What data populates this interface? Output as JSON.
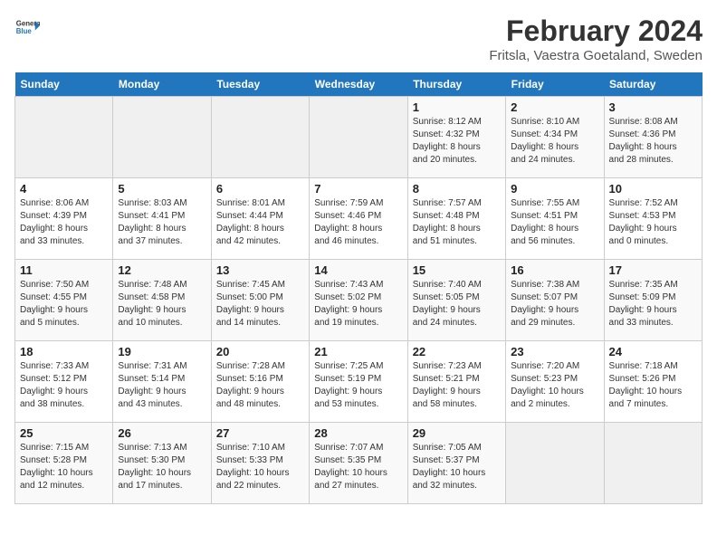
{
  "header": {
    "logo_line1": "General",
    "logo_line2": "Blue",
    "month": "February 2024",
    "location": "Fritsla, Vaestra Goetaland, Sweden"
  },
  "days_of_week": [
    "Sunday",
    "Monday",
    "Tuesday",
    "Wednesday",
    "Thursday",
    "Friday",
    "Saturday"
  ],
  "weeks": [
    [
      {
        "num": "",
        "info": ""
      },
      {
        "num": "",
        "info": ""
      },
      {
        "num": "",
        "info": ""
      },
      {
        "num": "",
        "info": ""
      },
      {
        "num": "1",
        "info": "Sunrise: 8:12 AM\nSunset: 4:32 PM\nDaylight: 8 hours\nand 20 minutes."
      },
      {
        "num": "2",
        "info": "Sunrise: 8:10 AM\nSunset: 4:34 PM\nDaylight: 8 hours\nand 24 minutes."
      },
      {
        "num": "3",
        "info": "Sunrise: 8:08 AM\nSunset: 4:36 PM\nDaylight: 8 hours\nand 28 minutes."
      }
    ],
    [
      {
        "num": "4",
        "info": "Sunrise: 8:06 AM\nSunset: 4:39 PM\nDaylight: 8 hours\nand 33 minutes."
      },
      {
        "num": "5",
        "info": "Sunrise: 8:03 AM\nSunset: 4:41 PM\nDaylight: 8 hours\nand 37 minutes."
      },
      {
        "num": "6",
        "info": "Sunrise: 8:01 AM\nSunset: 4:44 PM\nDaylight: 8 hours\nand 42 minutes."
      },
      {
        "num": "7",
        "info": "Sunrise: 7:59 AM\nSunset: 4:46 PM\nDaylight: 8 hours\nand 46 minutes."
      },
      {
        "num": "8",
        "info": "Sunrise: 7:57 AM\nSunset: 4:48 PM\nDaylight: 8 hours\nand 51 minutes."
      },
      {
        "num": "9",
        "info": "Sunrise: 7:55 AM\nSunset: 4:51 PM\nDaylight: 8 hours\nand 56 minutes."
      },
      {
        "num": "10",
        "info": "Sunrise: 7:52 AM\nSunset: 4:53 PM\nDaylight: 9 hours\nand 0 minutes."
      }
    ],
    [
      {
        "num": "11",
        "info": "Sunrise: 7:50 AM\nSunset: 4:55 PM\nDaylight: 9 hours\nand 5 minutes."
      },
      {
        "num": "12",
        "info": "Sunrise: 7:48 AM\nSunset: 4:58 PM\nDaylight: 9 hours\nand 10 minutes."
      },
      {
        "num": "13",
        "info": "Sunrise: 7:45 AM\nSunset: 5:00 PM\nDaylight: 9 hours\nand 14 minutes."
      },
      {
        "num": "14",
        "info": "Sunrise: 7:43 AM\nSunset: 5:02 PM\nDaylight: 9 hours\nand 19 minutes."
      },
      {
        "num": "15",
        "info": "Sunrise: 7:40 AM\nSunset: 5:05 PM\nDaylight: 9 hours\nand 24 minutes."
      },
      {
        "num": "16",
        "info": "Sunrise: 7:38 AM\nSunset: 5:07 PM\nDaylight: 9 hours\nand 29 minutes."
      },
      {
        "num": "17",
        "info": "Sunrise: 7:35 AM\nSunset: 5:09 PM\nDaylight: 9 hours\nand 33 minutes."
      }
    ],
    [
      {
        "num": "18",
        "info": "Sunrise: 7:33 AM\nSunset: 5:12 PM\nDaylight: 9 hours\nand 38 minutes."
      },
      {
        "num": "19",
        "info": "Sunrise: 7:31 AM\nSunset: 5:14 PM\nDaylight: 9 hours\nand 43 minutes."
      },
      {
        "num": "20",
        "info": "Sunrise: 7:28 AM\nSunset: 5:16 PM\nDaylight: 9 hours\nand 48 minutes."
      },
      {
        "num": "21",
        "info": "Sunrise: 7:25 AM\nSunset: 5:19 PM\nDaylight: 9 hours\nand 53 minutes."
      },
      {
        "num": "22",
        "info": "Sunrise: 7:23 AM\nSunset: 5:21 PM\nDaylight: 9 hours\nand 58 minutes."
      },
      {
        "num": "23",
        "info": "Sunrise: 7:20 AM\nSunset: 5:23 PM\nDaylight: 10 hours\nand 2 minutes."
      },
      {
        "num": "24",
        "info": "Sunrise: 7:18 AM\nSunset: 5:26 PM\nDaylight: 10 hours\nand 7 minutes."
      }
    ],
    [
      {
        "num": "25",
        "info": "Sunrise: 7:15 AM\nSunset: 5:28 PM\nDaylight: 10 hours\nand 12 minutes."
      },
      {
        "num": "26",
        "info": "Sunrise: 7:13 AM\nSunset: 5:30 PM\nDaylight: 10 hours\nand 17 minutes."
      },
      {
        "num": "27",
        "info": "Sunrise: 7:10 AM\nSunset: 5:33 PM\nDaylight: 10 hours\nand 22 minutes."
      },
      {
        "num": "28",
        "info": "Sunrise: 7:07 AM\nSunset: 5:35 PM\nDaylight: 10 hours\nand 27 minutes."
      },
      {
        "num": "29",
        "info": "Sunrise: 7:05 AM\nSunset: 5:37 PM\nDaylight: 10 hours\nand 32 minutes."
      },
      {
        "num": "",
        "info": ""
      },
      {
        "num": "",
        "info": ""
      }
    ]
  ]
}
